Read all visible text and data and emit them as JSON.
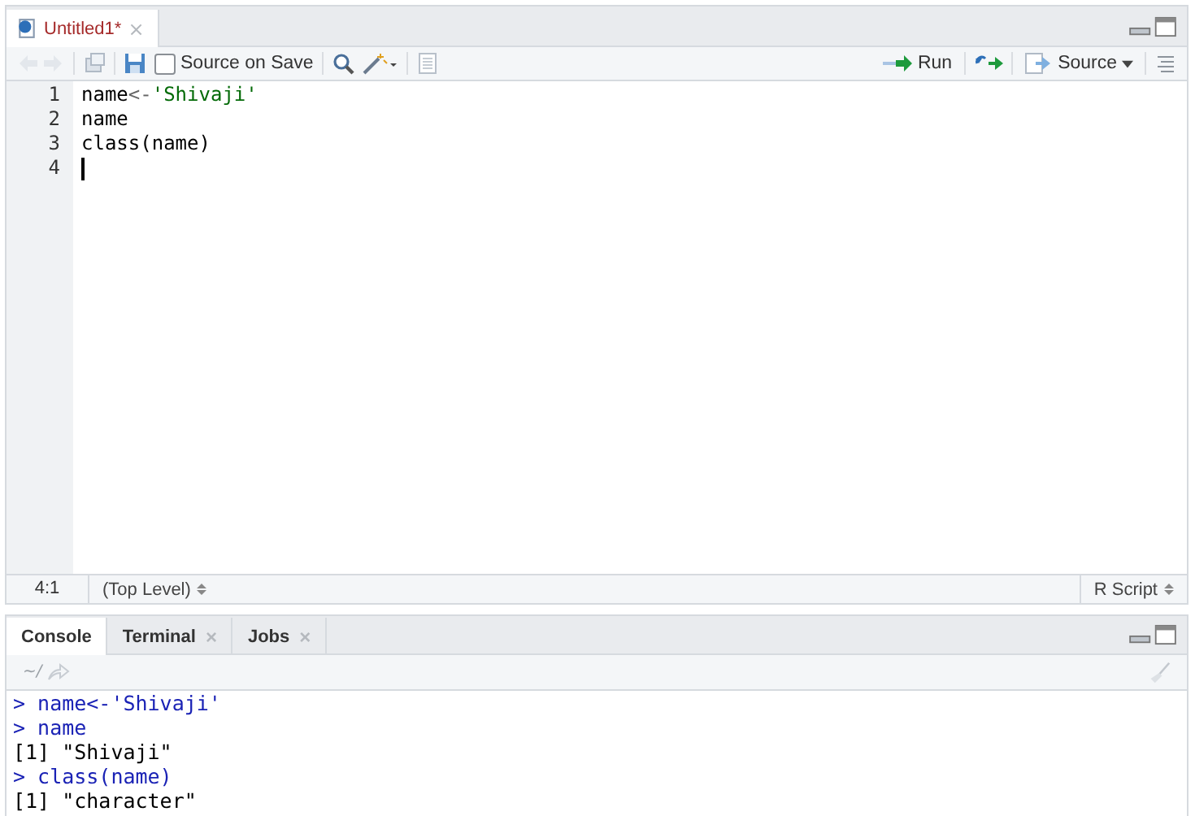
{
  "editor": {
    "tab": {
      "title": "Untitled1*",
      "close": "×",
      "modified": true
    },
    "toolbar": {
      "source_on_save": {
        "label": "Source on Save",
        "checked": false
      },
      "run": "Run",
      "source": "Source"
    },
    "lines": [
      {
        "number": "1",
        "segments": [
          {
            "kind": "code",
            "text": "name"
          },
          {
            "kind": "operator",
            "text": "<-"
          },
          {
            "kind": "string",
            "text": "'Shivaji'"
          }
        ]
      },
      {
        "number": "2",
        "segments": [
          {
            "kind": "code",
            "text": "name"
          }
        ]
      },
      {
        "number": "3",
        "segments": [
          {
            "kind": "code",
            "text": "class(name)"
          }
        ]
      },
      {
        "number": "4",
        "cursor": true
      }
    ],
    "status_bar": {
      "position": "4:1",
      "scope": "(Top Level)",
      "file_type": "R Script"
    }
  },
  "console": {
    "tabs": [
      {
        "label": "Console",
        "selected": true
      },
      {
        "label": "Terminal",
        "selected": false,
        "close": "×"
      },
      {
        "label": "Jobs",
        "selected": false,
        "close": "×"
      }
    ],
    "path": "~/",
    "lines": [
      {
        "kind": "input",
        "prompt": ">",
        "text": "name<-'Shivaji'"
      },
      {
        "kind": "input",
        "prompt": ">",
        "text": "name"
      },
      {
        "kind": "output",
        "text": "[1] \"Shivaji\""
      },
      {
        "kind": "input",
        "prompt": ">",
        "text": "class(name)"
      },
      {
        "kind": "output",
        "text": "[1] \"character\""
      }
    ]
  }
}
